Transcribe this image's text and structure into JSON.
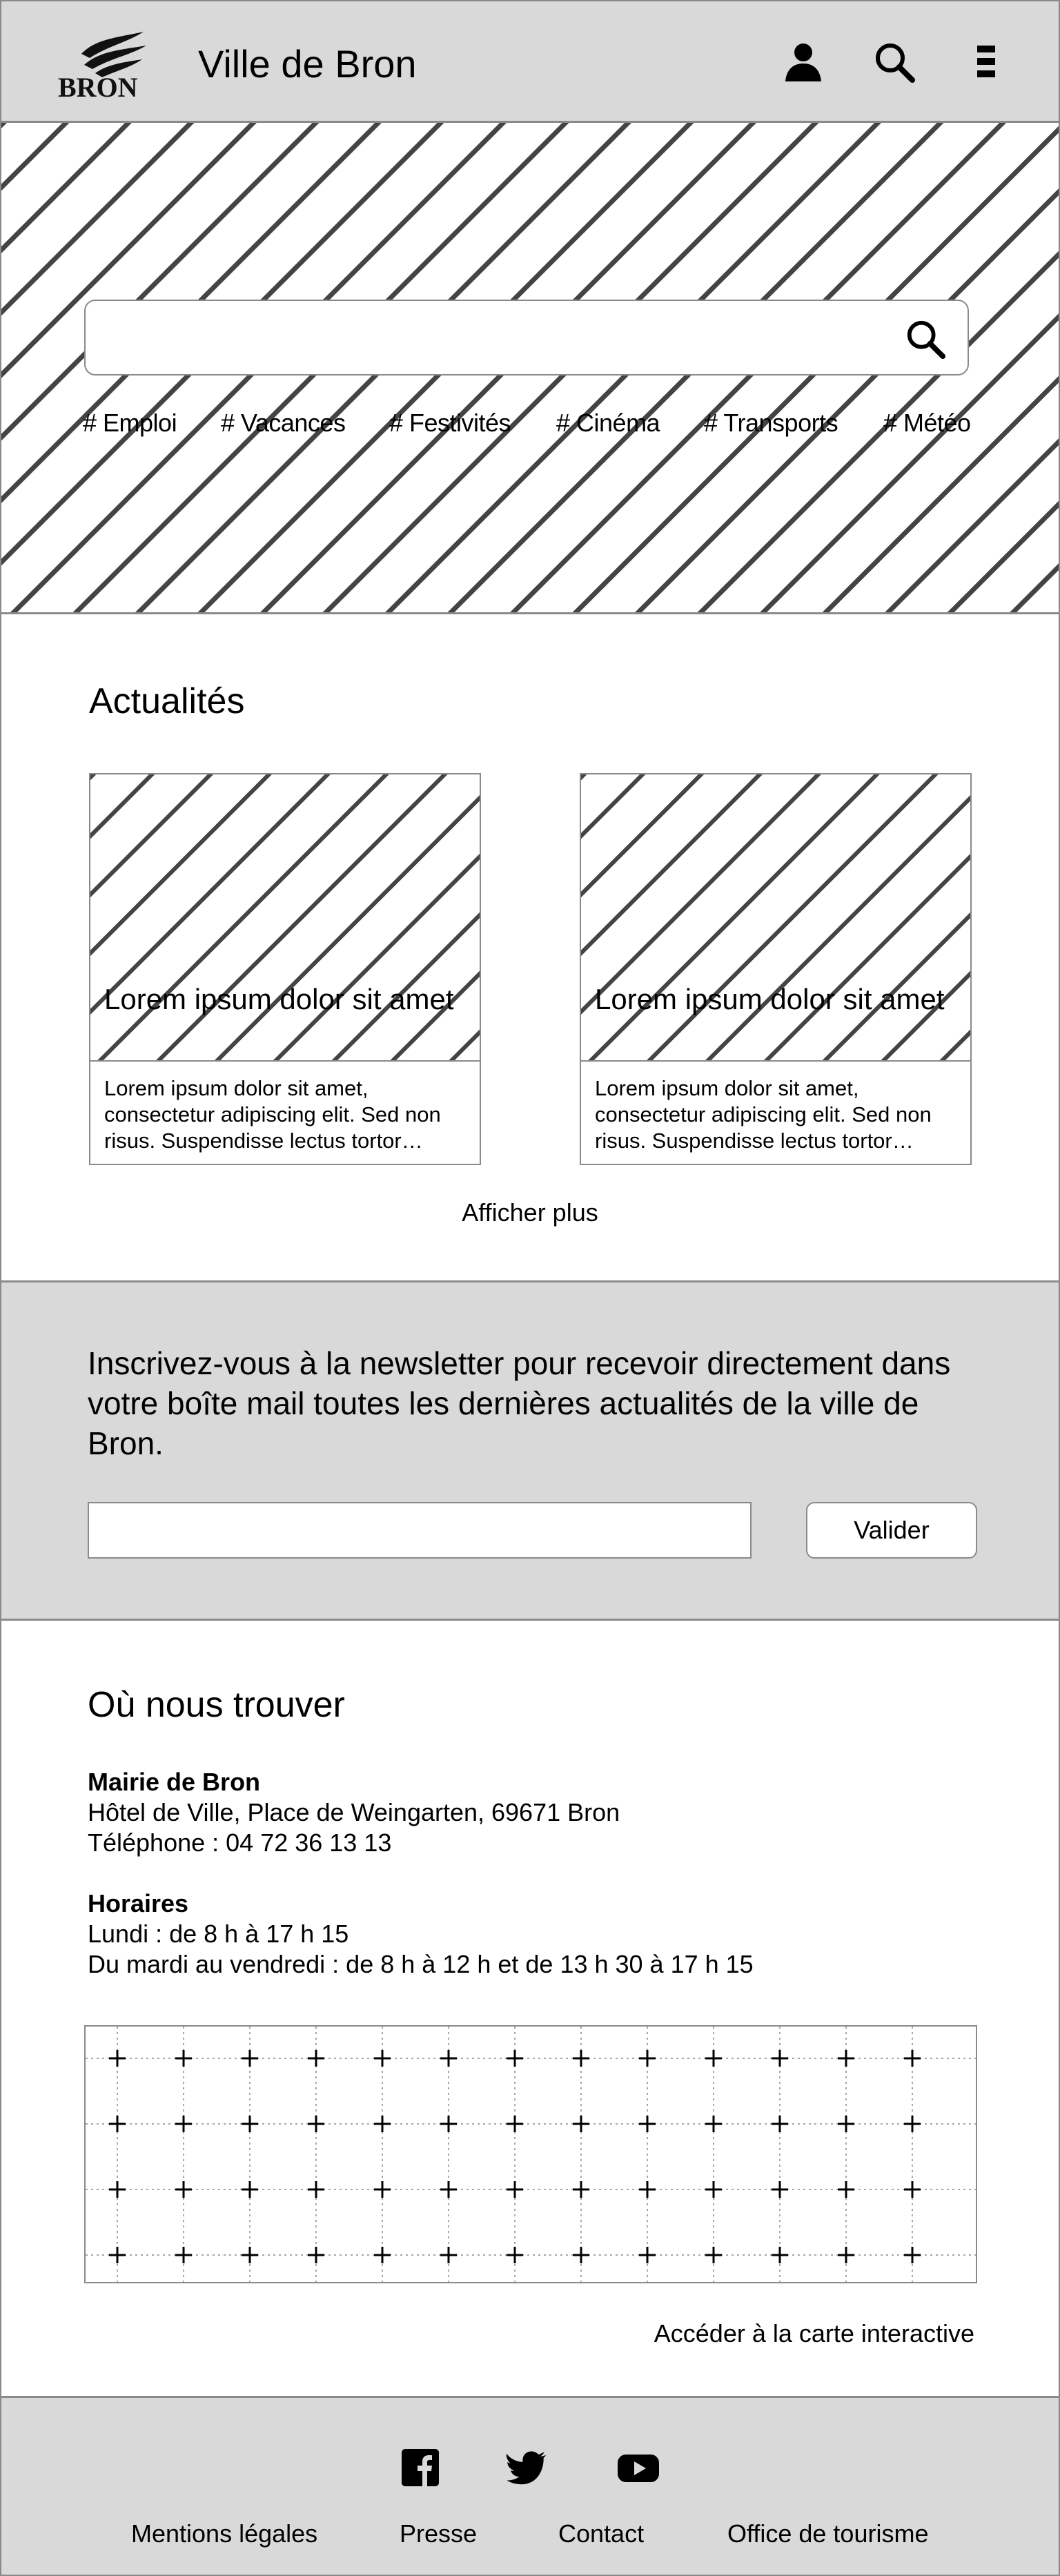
{
  "header": {
    "logo_text": "BRON",
    "site_title": "Ville de Bron",
    "icons": [
      "user-icon",
      "search-icon",
      "menu-icon"
    ]
  },
  "hero": {
    "search_placeholder": "",
    "tags": [
      "# Emploi",
      "# Vacances",
      "# Festivités",
      "# Cinéma",
      "# Transports",
      "# Météo"
    ]
  },
  "news": {
    "title": "Actualités",
    "cards": [
      {
        "title": "Lorem ipsum dolor sit amet",
        "text": "Lorem ipsum dolor sit amet, consectetur adipiscing elit. Sed non risus. Suspendisse lectus tortor…"
      },
      {
        "title": "Lorem ipsum dolor sit amet",
        "text": "Lorem ipsum dolor sit amet, consectetur adipiscing elit. Sed non risus. Suspendisse lectus tortor…"
      }
    ],
    "more_label": "Afficher plus"
  },
  "newsletter": {
    "text": "Inscrivez-vous à la newsletter pour recevoir directement dans votre boîte mail toutes les dernières actualités de la ville de Bron.",
    "email_placeholder": "",
    "submit_label": "Valider"
  },
  "location": {
    "title": "Où nous trouver",
    "office_name": "Mairie de Bron",
    "address": "Hôtel de Ville, Place de Weingarten, 69671 Bron",
    "phone": "Téléphone : 04 72 36 13 13",
    "hours_title": "Horaires",
    "hours_monday": "Lundi : de 8 h à 17 h 15",
    "hours_week": "Du mardi au vendredi : de 8 h à 12 h et de 13 h 30 à 17 h 15",
    "map_link": "Accéder à la carte interactive"
  },
  "footer": {
    "social": [
      "facebook-icon",
      "twitter-icon",
      "youtube-icon"
    ],
    "links": [
      "Mentions légales",
      "Presse",
      "Contact",
      "Office de tourisme"
    ]
  },
  "colors": {
    "gray_band": "#d9d9d9",
    "border": "#8a8a8a",
    "stripe": "#444444"
  }
}
